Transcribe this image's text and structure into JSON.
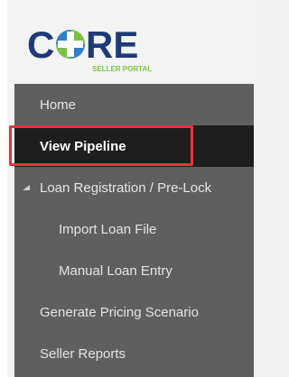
{
  "logo": {
    "text_prefix": "C",
    "text_suffix": "RE",
    "tagline": "SELLER PORTAL",
    "brand_colors": {
      "navy": "#1e3a78",
      "green": "#7cc243",
      "blue": "#2e7fc8"
    }
  },
  "nav": {
    "items": [
      {
        "label": "Home",
        "active": false,
        "level": 0
      },
      {
        "label": "View Pipeline",
        "active": true,
        "level": 0
      },
      {
        "label": "Loan Registration / Pre-Lock",
        "active": false,
        "level": 0,
        "expand_icon": "expanded-caret-icon"
      },
      {
        "label": "Import Loan File",
        "active": false,
        "level": 1
      },
      {
        "label": "Manual Loan Entry",
        "active": false,
        "level": 1
      },
      {
        "label": "Generate Pricing Scenario",
        "active": false,
        "level": 0
      },
      {
        "label": "Seller Reports",
        "active": false,
        "level": 0
      }
    ]
  },
  "colors": {
    "nav_bg": "#5f5f5f",
    "active_bg": "#1e1e1e",
    "highlight_border": "#e8333b"
  }
}
